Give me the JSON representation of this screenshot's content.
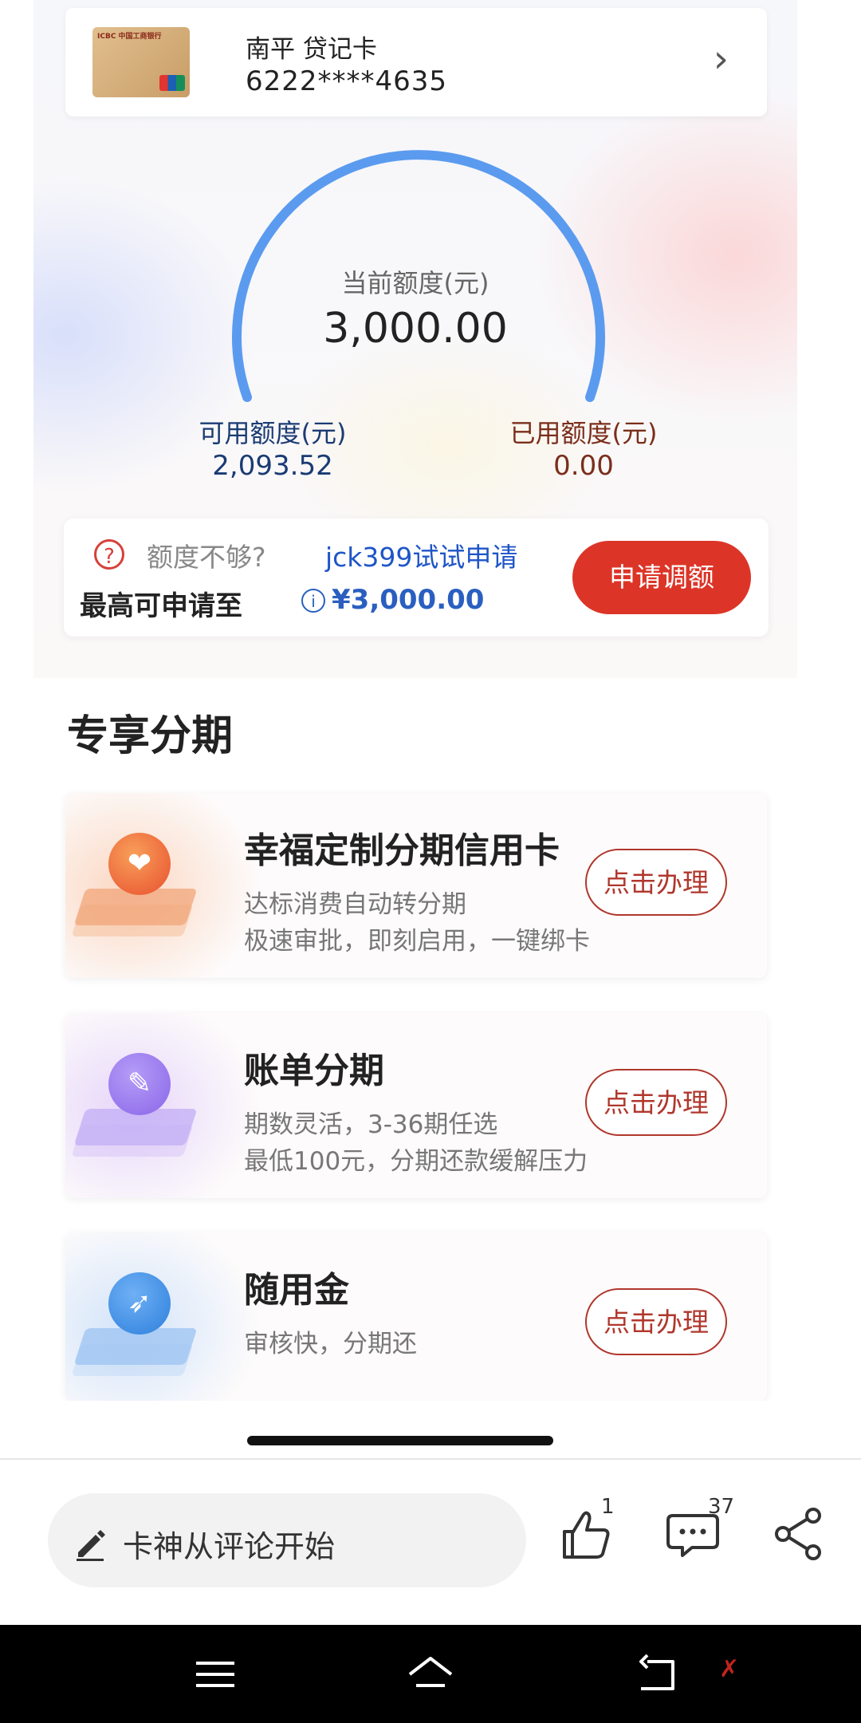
{
  "card": {
    "name": "南平 贷记卡",
    "number": "6222****4635",
    "bank_mark": "ICBC 中国工商银行"
  },
  "limits": {
    "current_label": "当前额度(元)",
    "current_value": "3,000.00",
    "available_label": "可用额度(元)",
    "available_value": "2,093.52",
    "used_label": "已用额度(元)",
    "used_value": "0.00"
  },
  "quota": {
    "prompt": "额度不够?",
    "overlay_text": "jck399试试申请",
    "max_label": "最高可申请至",
    "max_value": "¥3,000.00",
    "apply_button": "申请调额"
  },
  "section_title": "专享分期",
  "products": [
    {
      "title": "幸福定制分期信用卡",
      "line1": "达标消费自动转分期",
      "line2": "极速审批，即刻启用，一键绑卡",
      "button": "点击办理",
      "icon": "heart-icon",
      "accent": "#f07a4a"
    },
    {
      "title": "账单分期",
      "line1": "期数灵活，3-36期任选",
      "line2": "最低100元，分期还款缓解压力",
      "button": "点击办理",
      "icon": "pen-icon",
      "accent": "#9b7ff0"
    },
    {
      "title": "随用金",
      "line1": "审核快，分期还",
      "line2": "",
      "button": "点击办理",
      "icon": "rocket-icon",
      "accent": "#4a90e2"
    }
  ],
  "comment_bar": {
    "placeholder": "卡神从评论开始",
    "like_count": "1",
    "comment_count": "37"
  },
  "colors": {
    "gauge_arc": "#5b9bef",
    "apply_red": "#dc3528",
    "link_blue": "#2a5fc0",
    "outline_red": "#b0372c"
  }
}
